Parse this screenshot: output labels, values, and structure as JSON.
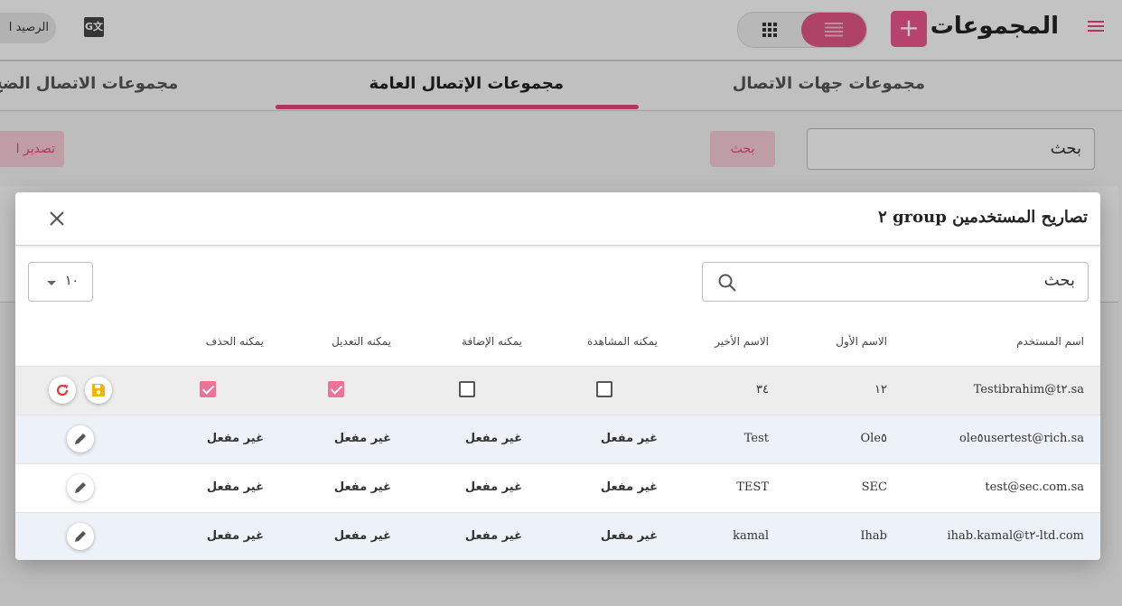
{
  "app": {
    "title": "المجموعات",
    "balance_label": "الرصيد ا",
    "translate_icon": "G文"
  },
  "tabs": [
    {
      "label": "مجموعات جهات الاتصال",
      "active": false
    },
    {
      "label": "مجموعات الإتصال العامة",
      "active": true
    },
    {
      "label": "مجموعات الاتصال الضخ",
      "active": false
    }
  ],
  "toolbar": {
    "search_value": "بحث",
    "search_button": "بحث",
    "export_button": "تصدير ا"
  },
  "modal": {
    "title": "٢ group تصاريح المستخدمين",
    "search_value": "بحث",
    "page_size": "١٠",
    "columns": [
      "اسم المستخدم",
      "الاسم الأول",
      "الاسم الأخير",
      "يمكنه المشاهدة",
      "يمكنه الإضافة",
      "يمكنه التعديل",
      "يمكنه الحذف"
    ],
    "editing_row": {
      "username": "Testibrahim@t٢.sa",
      "first_name": "١٢",
      "last_name": "٣٤",
      "can_view": false,
      "can_add": false,
      "can_edit": true,
      "can_delete": true
    },
    "rows": [
      {
        "username": "ole٥usertest@rich.sa",
        "first_name": "Ole٥",
        "last_name": "Test",
        "can_view": "غير مفعل",
        "can_add": "غير مفعل",
        "can_edit": "غير مفعل",
        "can_delete": "غير مفعل"
      },
      {
        "username": "test@sec.com.sa",
        "first_name": "SEC",
        "last_name": "TEST",
        "can_view": "غير مفعل",
        "can_add": "غير مفعل",
        "can_edit": "غير مفعل",
        "can_delete": "غير مفعل"
      },
      {
        "username": "ihab.kamal@t٢-ltd.com",
        "first_name": "Ihab",
        "last_name": "kamal",
        "can_view": "غير مفعل",
        "can_add": "غير مفعل",
        "can_edit": "غير مفعل",
        "can_delete": "غير مفعل"
      }
    ]
  },
  "colors": {
    "accent": "#e0487c",
    "checkbox_checked": "#ee7196",
    "save_icon": "#f5b400",
    "refresh_icon": "#e53935"
  }
}
